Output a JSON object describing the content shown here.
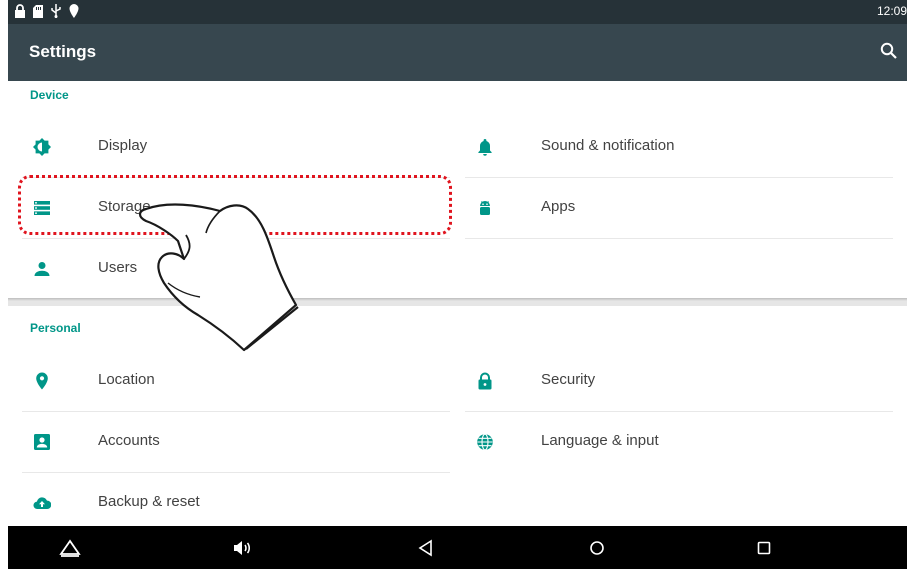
{
  "status_bar": {
    "time": "12:09",
    "icons": [
      "lock-icon",
      "sd-card-icon",
      "usb-icon",
      "location-pin-icon"
    ]
  },
  "toolbar": {
    "title": "Settings",
    "search_icon": "search-icon"
  },
  "sections": {
    "device": {
      "header": "Device",
      "items": [
        {
          "label": "Display",
          "icon": "brightness-icon"
        },
        {
          "label": "Sound & notification",
          "icon": "bell-icon"
        },
        {
          "label": "Storage",
          "icon": "storage-icon"
        },
        {
          "label": "Apps",
          "icon": "android-icon"
        },
        {
          "label": "Users",
          "icon": "person-icon"
        }
      ]
    },
    "personal": {
      "header": "Personal",
      "items": [
        {
          "label": "Location",
          "icon": "location-icon"
        },
        {
          "label": "Security",
          "icon": "lock-icon"
        },
        {
          "label": "Accounts",
          "icon": "account-box-icon"
        },
        {
          "label": "Language & input",
          "icon": "globe-icon"
        },
        {
          "label": "Backup & reset",
          "icon": "cloud-upload-icon"
        }
      ]
    }
  },
  "nav_bar": {
    "buttons": [
      "up-arrow-icon",
      "volume-icon",
      "back-icon",
      "home-icon",
      "recents-icon"
    ]
  },
  "colors": {
    "status_bar": "#263238",
    "toolbar": "#37474f",
    "accent": "#009688",
    "icon": "#009688",
    "highlight": "#e0141e"
  }
}
